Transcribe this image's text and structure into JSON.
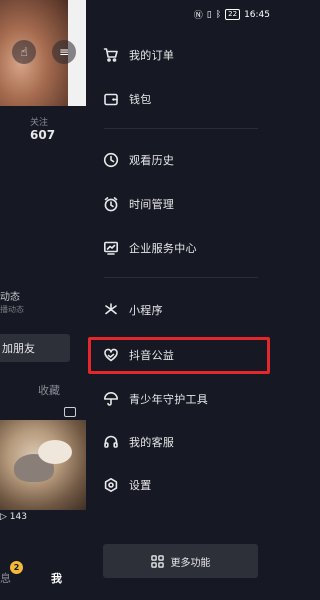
{
  "status_bar": {
    "time": "16:45",
    "battery": "22"
  },
  "background_profile": {
    "following_label": "关注",
    "following_count": "607",
    "dynamics_title": "动态",
    "dynamics_sub": "播动态",
    "add_friend": "加朋友",
    "collect_tab": "收藏",
    "video_views": "143",
    "tabbar": {
      "messages": "息",
      "messages_badge": "2",
      "me": "我"
    }
  },
  "drawer": {
    "menu": [
      {
        "name": "orders",
        "icon": "cart-icon",
        "label": "我的订单"
      },
      {
        "name": "wallet",
        "icon": "wallet-icon",
        "label": "钱包"
      },
      {
        "name": "history",
        "icon": "clock-icon",
        "label": "观看历史"
      },
      {
        "name": "time-management",
        "icon": "alarm-icon",
        "label": "时间管理"
      },
      {
        "name": "enterprise-center",
        "icon": "monitor-chart-icon",
        "label": "企业服务中心"
      },
      {
        "name": "mini-programs",
        "icon": "asterisk-icon",
        "label": "小程序"
      },
      {
        "name": "charity",
        "icon": "heart-hands-icon",
        "label": "抖音公益"
      },
      {
        "name": "youth-protection",
        "icon": "umbrella-icon",
        "label": "青少年守护工具"
      },
      {
        "name": "customer-service",
        "icon": "headset-icon",
        "label": "我的客服"
      },
      {
        "name": "settings",
        "icon": "hexagon-gear-icon",
        "label": "设置"
      }
    ],
    "more_button": {
      "icon": "grid-icon",
      "label": "更多功能"
    },
    "highlight_color": "#e3272a"
  }
}
